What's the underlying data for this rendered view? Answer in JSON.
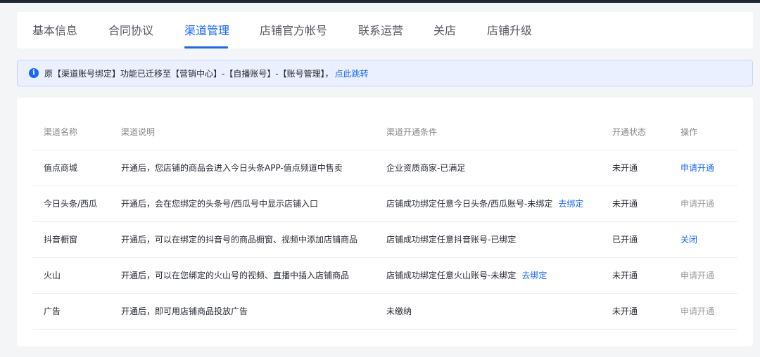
{
  "tabs": [
    {
      "label": "基本信息"
    },
    {
      "label": "合同协议"
    },
    {
      "label": "渠道管理",
      "active": true
    },
    {
      "label": "店铺官方帐号"
    },
    {
      "label": "联系运营"
    },
    {
      "label": "关店"
    },
    {
      "label": "店铺升级"
    }
  ],
  "notice": {
    "text": "原【渠道账号绑定】功能已迁移至【营销中心】-【自播账号】-【账号管理】，",
    "link": "点此跳转",
    "icon": "info-icon"
  },
  "table": {
    "headers": [
      "渠道名称",
      "渠道说明",
      "渠道开通条件",
      "开通状态",
      "操作"
    ],
    "rows": [
      {
        "name": "值点商城",
        "desc": "开通后，您店铺的商品会进入今日头条APP-值点频道中售卖",
        "condition": "企业资质商家-已满足",
        "bind_link": "",
        "status": "未开通",
        "action": "申请开通",
        "action_style": "link"
      },
      {
        "name": "今日头条/西瓜",
        "desc": "开通后，会在您绑定的头条号/西瓜号中显示店铺入口",
        "condition": "店铺成功绑定任意今日头条/西瓜账号-未绑定",
        "bind_link": "去绑定",
        "status": "未开通",
        "action": "申请开通",
        "action_style": "muted"
      },
      {
        "name": "抖音橱窗",
        "desc": "开通后，可以在绑定的抖音号的商品橱窗、视频中添加店铺商品",
        "condition": "店铺成功绑定任意抖音账号-已绑定",
        "bind_link": "",
        "status": "已开通",
        "action": "关闭",
        "action_style": "link"
      },
      {
        "name": "火山",
        "desc": "开通后，可以在您绑定的火山号的视频、直播中插入店铺商品",
        "condition": "店铺成功绑定任意火山账号-未绑定",
        "bind_link": "去绑定",
        "status": "未开通",
        "action": "申请开通",
        "action_style": "muted"
      },
      {
        "name": "广告",
        "desc": "开通后，即可用店铺商品投放广告",
        "condition": "未缴纳",
        "bind_link": "",
        "status": "未开通",
        "action": "申请开通",
        "action_style": "muted"
      }
    ]
  },
  "colors": {
    "accent": "#1966ff",
    "notice_bg": "#eaf0ff",
    "muted": "#999b9f"
  }
}
